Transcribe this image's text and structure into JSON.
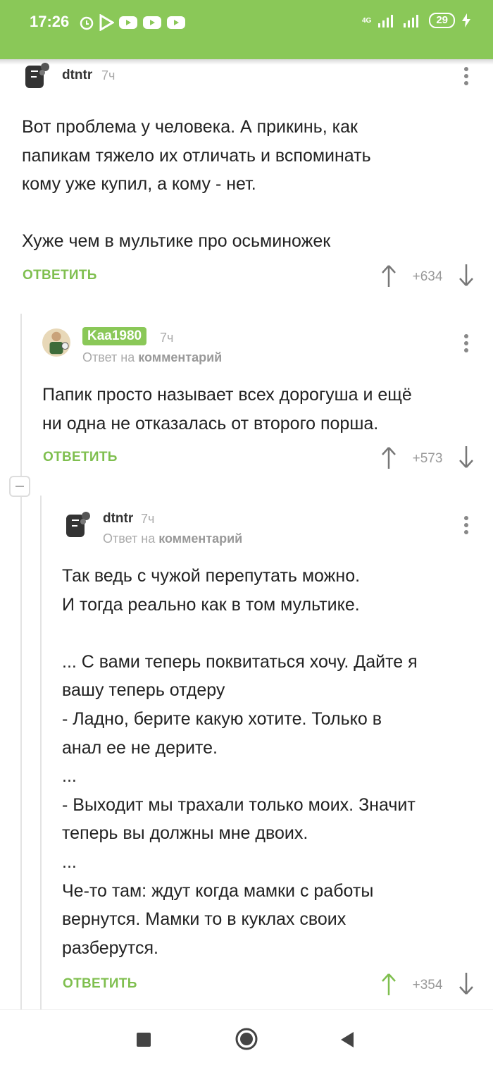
{
  "status_bar": {
    "time": "17:26",
    "signal_label": "4G",
    "battery": "29"
  },
  "comments": [
    {
      "user": "dtntr",
      "time": "7ч",
      "text": "Вот проблема у человека. А прикинь, как\nпапикам тяжело их отличать и вспоминать\nкому уже купил, а кому - нет.\n\nХуже чем в мультике про осьминожек",
      "reply_label": "ОТВЕТИТЬ",
      "rating": "+634"
    },
    {
      "user": "Kaa1980",
      "time": "7ч",
      "reply_to_prefix": "Ответ на",
      "reply_to_target": "комментарий",
      "text": "Папик просто называет всех дорогуша и ещё\nни одна не отказалась от второго порша.",
      "reply_label": "ОТВЕТИТЬ",
      "rating": "+573"
    },
    {
      "user": "dtntr",
      "time": "7ч",
      "reply_to_prefix": "Ответ на",
      "reply_to_target": "комментарий",
      "text": "Так ведь с чужой перепутать можно.\nИ тогда реально как в том мультике.\n\n... С вами теперь поквитаться хочу. Дайте я\nвашу теперь отдеру\n- Ладно, берите какую хотите. Только в\nанал ее не дерите.\n...\n- Выходит мы трахали только моих. Значит\nтеперь вы должны мне двоих.\n...\nЧе-то там: ждут когда мамки с работы\nвернутся. Мамки то в куклах своих\nразберутся.",
      "reply_label": "ОТВЕТИТЬ",
      "rating": "+354"
    }
  ],
  "colors": {
    "accent": "#8ac858",
    "reply": "#7fbf4f",
    "upvoted": "#7fbf4f",
    "muted": "#999999"
  }
}
